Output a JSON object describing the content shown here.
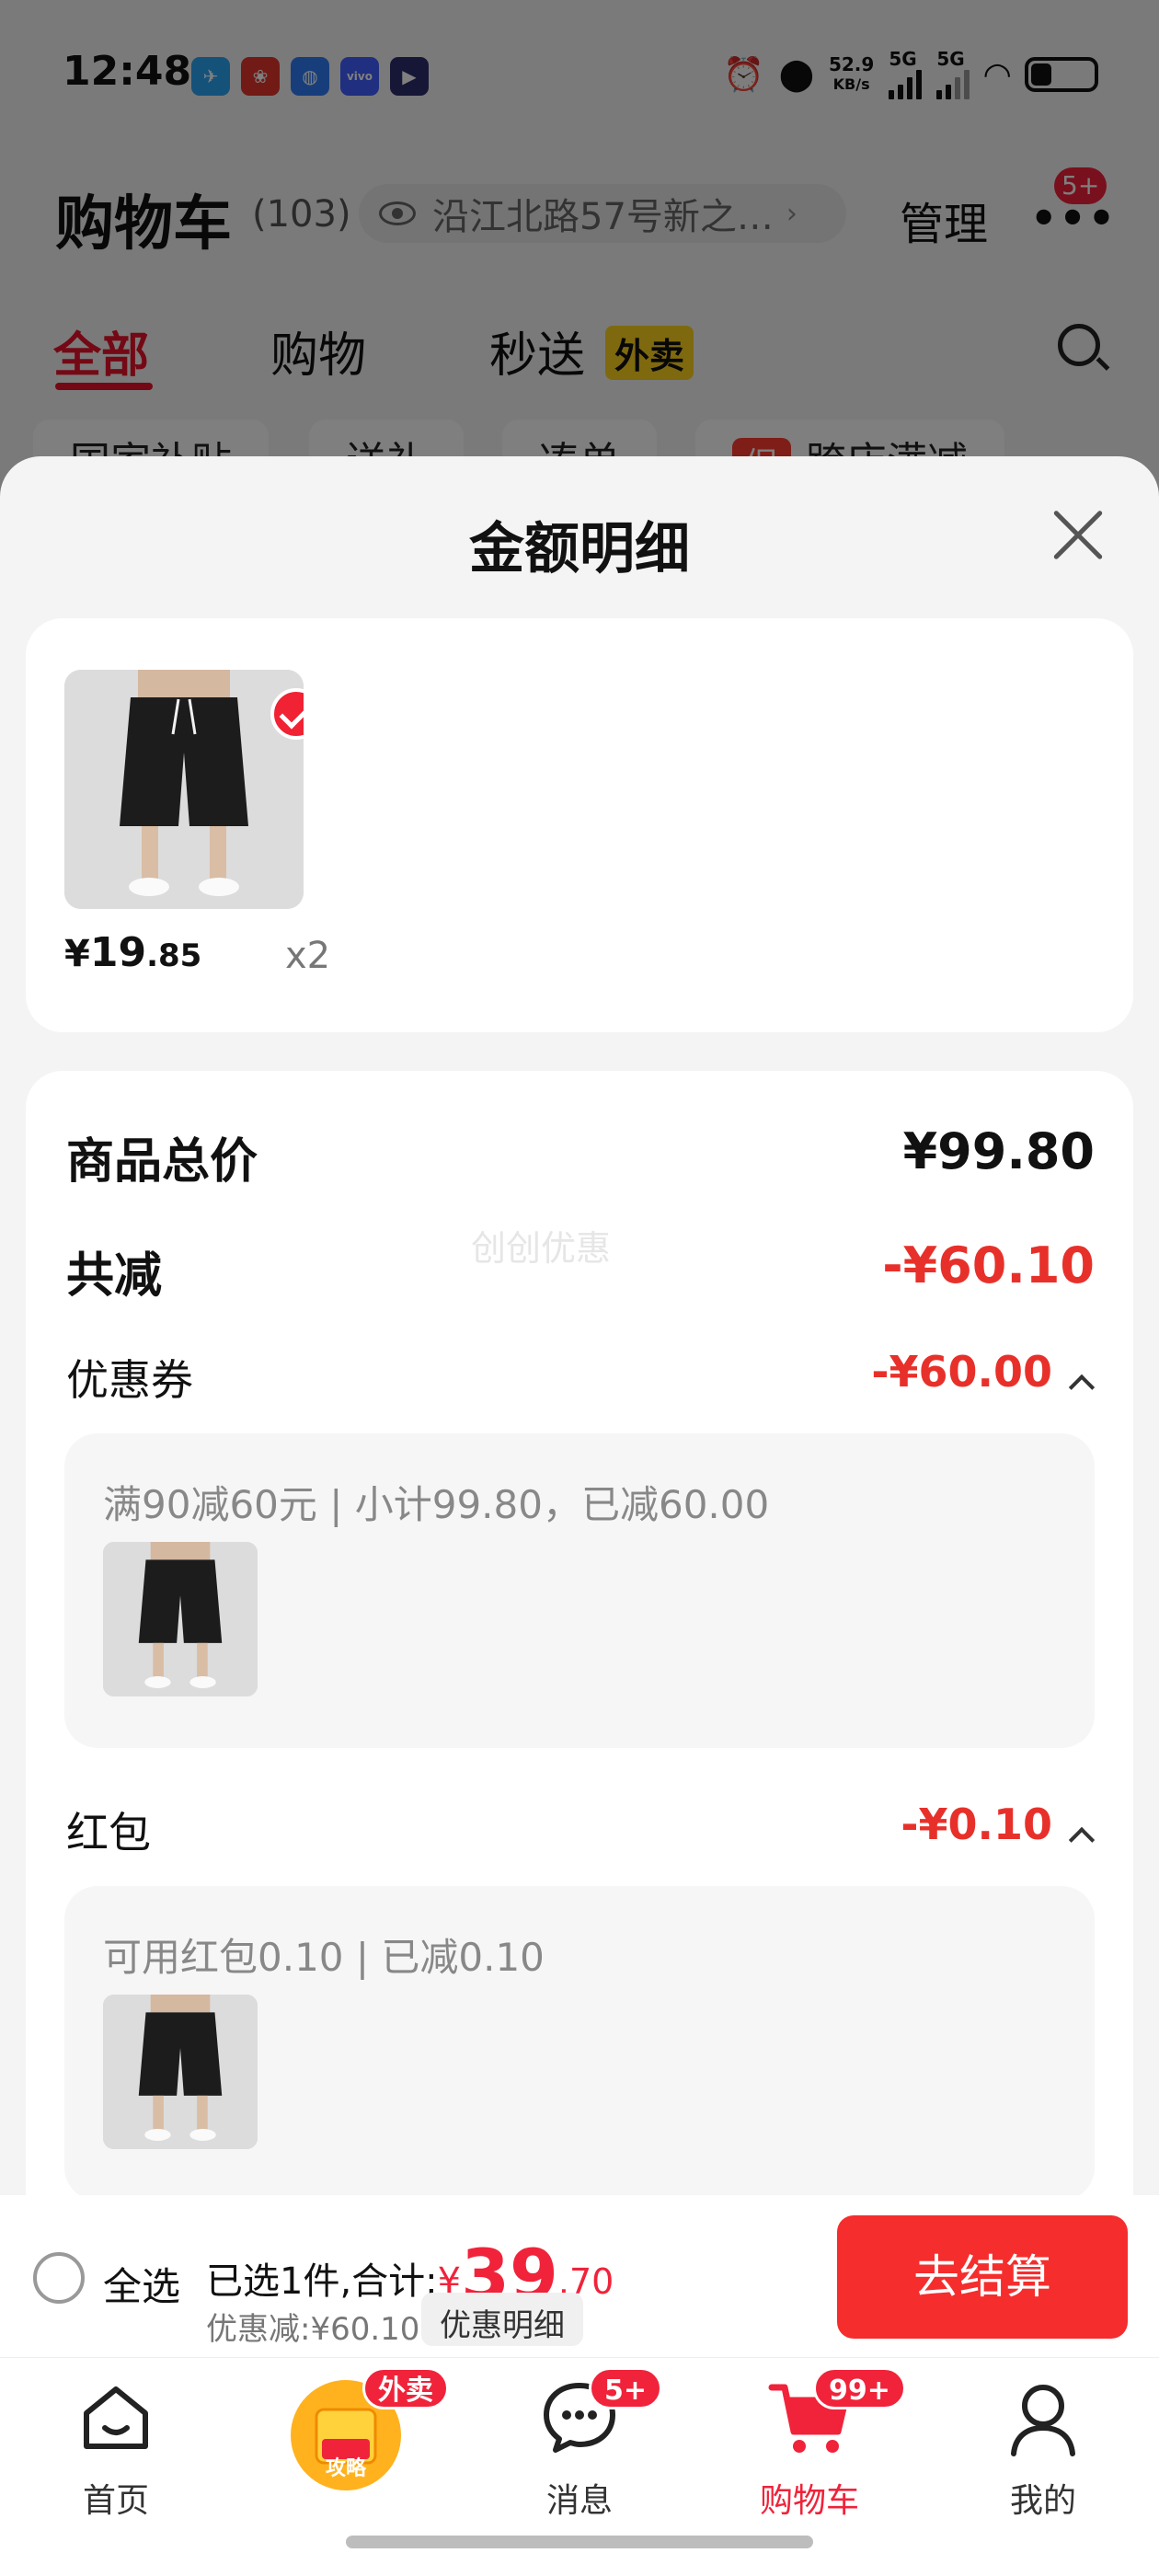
{
  "status_bar": {
    "time": "12:48",
    "speed_value": "52.9",
    "speed_unit": "KB/s",
    "net1": "5G",
    "net2": "5G"
  },
  "header": {
    "title": "购物车",
    "count": "(103)",
    "address": "沿江北路57号新之…",
    "manage_label": "管理",
    "more_badge": "5+"
  },
  "tabs": [
    {
      "label": "全部",
      "active": true
    },
    {
      "label": "购物",
      "active": false
    },
    {
      "label": "秒送",
      "active": false,
      "tag": "外卖"
    }
  ],
  "filter_chips": [
    {
      "label": "国家补贴"
    },
    {
      "label": "送礼"
    },
    {
      "label": "凑单"
    },
    {
      "tag": "促",
      "label": "跨店满减"
    }
  ],
  "sheet": {
    "title": "金额明细",
    "goods": {
      "price_symbol": "¥",
      "price_int": "19",
      "price_dec": ".85",
      "qty": "x2"
    },
    "total_label": "商品总价",
    "total_value": "¥99.80",
    "reduce_label": "共减",
    "reduce_value": "-¥60.10",
    "watermark": "创创优惠",
    "coupon": {
      "label": "优惠券",
      "value": "-¥60.00",
      "detail": "满90减60元 | 小计99.80，已减60.00"
    },
    "red_packet": {
      "label": "红包",
      "value": "-¥0.10",
      "detail": "可用红包0.10 | 已减0.10"
    }
  },
  "checkout": {
    "select_all": "全选",
    "summary_prefix": "已选1件,合计:",
    "total_symbol": "¥",
    "total_int": "39",
    "total_dec": ".70",
    "discount_line": "优惠减:¥60.10",
    "discount_detail_button": "优惠明细",
    "checkout_button": "去结算"
  },
  "bottom_nav": [
    {
      "label": "首页",
      "icon": "home-icon"
    },
    {
      "label": "攻略",
      "icon": "promo-bag-icon",
      "badge": "外卖"
    },
    {
      "label": "消息",
      "icon": "message-icon",
      "badge": "5+"
    },
    {
      "label": "购物车",
      "icon": "cart-icon",
      "badge": "99+",
      "active": true
    },
    {
      "label": "我的",
      "icon": "profile-icon"
    }
  ],
  "colors": {
    "accent_red": "#f0233a",
    "price_red": "#e8302a",
    "tag_yellow": "#ffd21f"
  }
}
